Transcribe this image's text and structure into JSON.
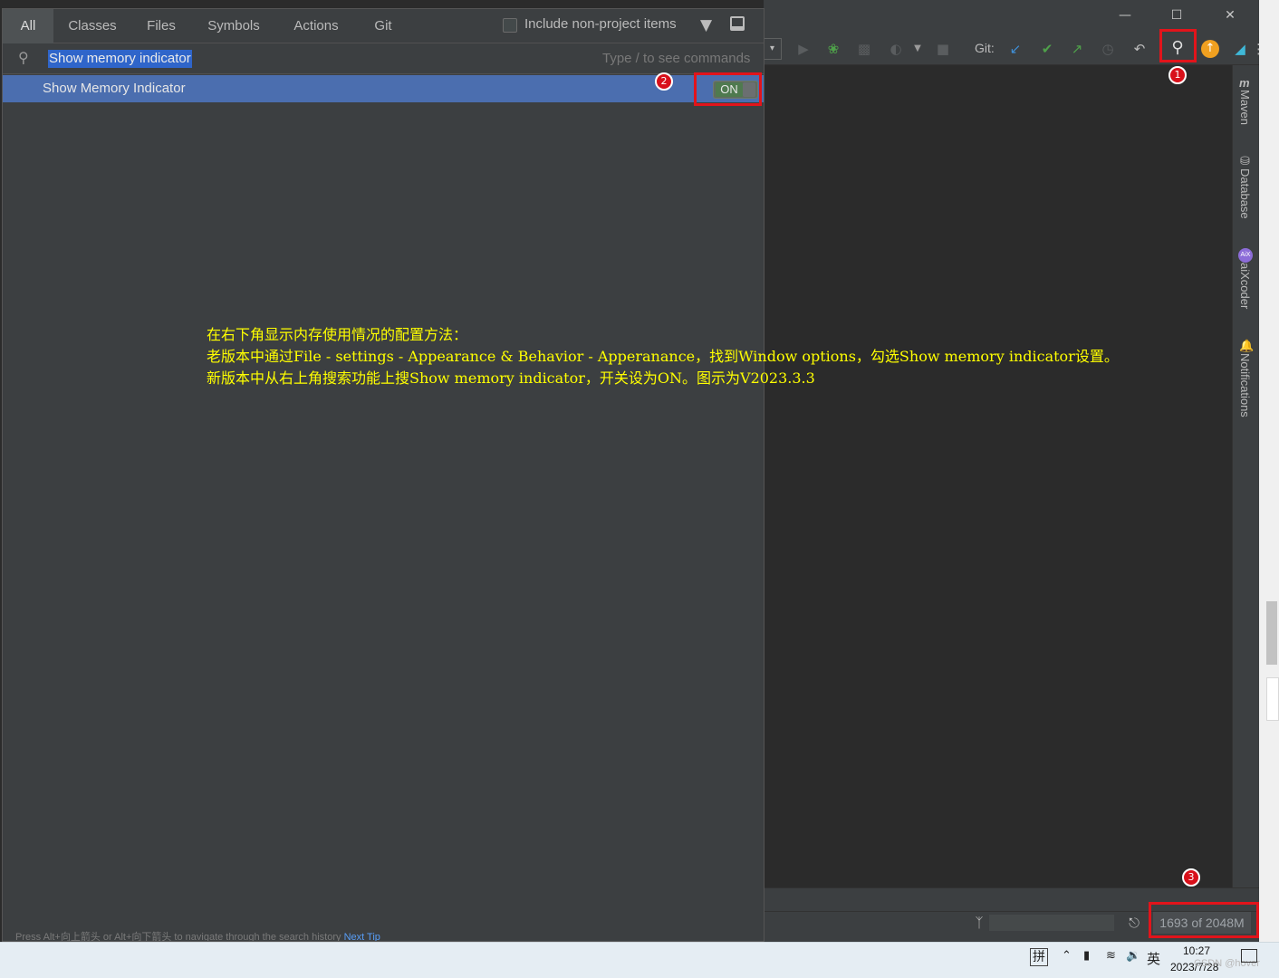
{
  "search_popup": {
    "tabs": [
      "All",
      "Classes",
      "Files",
      "Symbols",
      "Actions",
      "Git"
    ],
    "active_tab": "All",
    "include_non_project_label": "Include non-project items",
    "include_non_project_checked": false,
    "search_value": "Show memory indicator",
    "search_hint": "Type / to see commands",
    "results": [
      {
        "label": "Show Memory Indicator",
        "toggle": "ON"
      }
    ],
    "footer_text": "Press Alt+向上箭头 or Alt+向下箭头 to navigate through the search history",
    "footer_link": "Next Tip"
  },
  "toolbar": {
    "git_label": "Git:"
  },
  "right_sidebar": {
    "items": [
      "Maven",
      "Database",
      "aiXcoder",
      "Notifications"
    ]
  },
  "status_bar": {
    "memory": "1693 of 2048M"
  },
  "markers": [
    "1",
    "2",
    "3"
  ],
  "annotation": {
    "line1": "在右下角显示内存使用情况的配置方法：",
    "line2": "老版本中通过File - settings - Appearance & Behavior - Apperanance，找到Window options，勾选Show memory indicator设置。",
    "line3": "新版本中从右上角搜索功能上搜Show memory indicator，开关设为ON。图示为V2023.3.3"
  },
  "taskbar": {
    "ime_mode": "拼",
    "ime_lang": "英",
    "time": "10:27",
    "date": "2023/7/28",
    "watermark": "CSDN @hover"
  },
  "colors": {
    "annotation": "#ffff00",
    "highlight_box": "#e2141b",
    "selection": "#4b6eaf"
  }
}
